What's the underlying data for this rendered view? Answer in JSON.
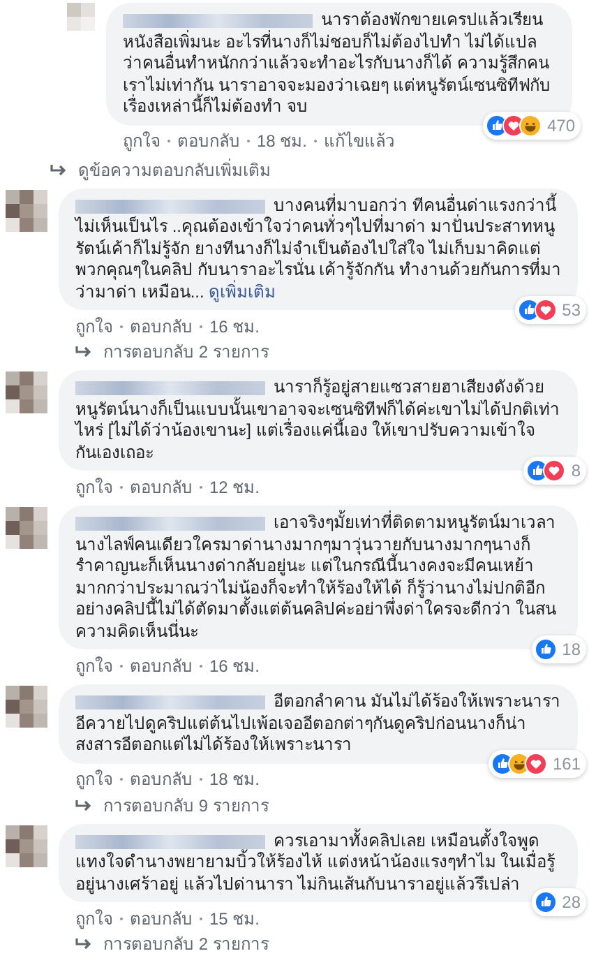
{
  "comments": [
    {
      "kind": "reply",
      "text": "นาราต้องพักขายเครปแล้วเรียนหนังสือเพิ่มนะ อะไรที่นางก็ไม่ชอบก็ไม่ต้องไปทำ ไม่ได้แปลว่าคนอื่นทำหนักกว่าแล้วจะทำอะไรกับนางก็ได้ ความรู้สึกคนเราไม่เท่ากัน นาราอาจจะมองว่าเฉยๆ แต่หนูรัตน์เซนซิทีฟกับเรื่องเหล่านี้ก็ไม่ต้องทำ จบ",
      "reactions": [
        {
          "kind": "like"
        },
        {
          "kind": "love"
        },
        {
          "kind": "haha"
        }
      ],
      "count": "470",
      "actions": [
        "ถูกใจ",
        "ตอบกลับ",
        "18 ชม.",
        "แก้ไขแล้ว"
      ],
      "replies_link": "ดูข้อความตอบกลับเพิ่มเติม"
    },
    {
      "kind": "comment",
      "text": "บางคนที่มาบอกว่า ทีคนอื่นด่าแรงกว่านี้ไม่เห็นเป็นไร ..คุณต้องเข้าใจว่าคนทั่วๆไปที่มาด่า มาปั่นประสาทหนูรัตน์เค้าก็ไม่รู้จัก ยางทีนางก็ไม่จำเป็นต้องไปใส่ใจ ไม่เก็บมาคิดแต่พวกคุณๆในคลิป กับนาราอะไรนั่น เค้ารู้จักกัน ทำงานด้วยกันการที่มาว่ามาด่า เหมือน...",
      "see_more": "ดูเพิ่มเติม",
      "reactions": [
        {
          "kind": "like"
        },
        {
          "kind": "love"
        }
      ],
      "count": "53",
      "actions": [
        "ถูกใจ",
        "ตอบกลับ",
        "16 ชม."
      ],
      "replies_link": "การตอบกลับ 2 รายการ"
    },
    {
      "kind": "comment",
      "text": "นาราก็รู้อยู่สายแซวสายฮาเสียงดังด้วยหนูรัตน์นางก็เป็นแบบนั้นเขาอาจจะเซนซิทีฟก็ได้ค่ะเขาไม่ได้ปกติเท่าไหร่ [ไม่ได้ว่าน้องเขานะ] แต่เรื่องแค่นี้เอง ให้เขาปรับความเข้าใจกันเองเถอะ",
      "reactions": [
        {
          "kind": "like"
        },
        {
          "kind": "love"
        }
      ],
      "count": "8",
      "actions": [
        "ถูกใจ",
        "ตอบกลับ",
        "12 ชม."
      ]
    },
    {
      "kind": "comment",
      "text": "เอาจริงๆมั้ยเท่าที่ติดตามหนูรัตน์มาเวลานางไลฟ์คนเดียวใครมาด่านางมากๆมาวุ่นวายกับนางมากๆนางก็รำคาญนะก็เห็นนางด่ากลับอยู่นะ แต่ในกรณีนี้นางคงจะมีคนเหย้ามากกว่าประมาณว่าไม่น้องก็จะทำให้ร้องให้ได้ ก็รู้ว่านางไม่ปกติอีกอย่างคลิปนี้ไม่ได้ตัดมาตั้งแต่ต้นคลิปค่ะอย่าพึ่งด่าใครจะดีกว่า ในสนความคิดเห็นนี่นะ",
      "reactions": [
        {
          "kind": "like"
        }
      ],
      "count": "18",
      "actions": [
        "ถูกใจ",
        "ตอบกลับ",
        "16 ชม."
      ]
    },
    {
      "kind": "comment",
      "text": "อีตอกลำคาน มันไม่ได้ร้องให้เพราะนาราอีควายไปดูคริปแต่ต้นไปเพ้อเจออีตอกต่าๆกันดูคริปก่อนนางก็น่าสงสารอีตอกแต่ไม่ได้ร้องให้เพราะนารา",
      "reactions": [
        {
          "kind": "like"
        },
        {
          "kind": "haha"
        },
        {
          "kind": "love"
        }
      ],
      "count": "161",
      "actions": [
        "ถูกใจ",
        "ตอบกลับ",
        "18 ชม."
      ],
      "replies_link": "การตอบกลับ 9 รายการ"
    },
    {
      "kind": "comment",
      "text": "ควรเอามาทั้งคลิปเลย เหมือนตั้งใจพูดแทงใจดำนางพยายามบิ้วให้ร้องไห้ แต่งหน้าน้องแรงๆทำไม ในเมื่อรู้อยู่นางเศร้าอยู่ แล้วไปด่านารา ไม่กินเส้นกับนาราอยู่แล้วรึเปล่า",
      "reactions": [
        {
          "kind": "like"
        }
      ],
      "count": "28",
      "actions": [
        "ถูกใจ",
        "ตอบกลับ",
        "15 ชม."
      ],
      "replies_link": "การตอบกลับ 2 รายการ"
    }
  ]
}
